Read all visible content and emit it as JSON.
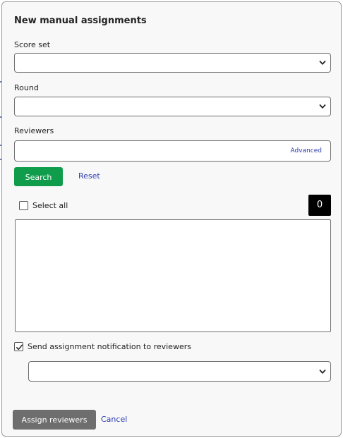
{
  "modal": {
    "title": "New manual assignments"
  },
  "score_set": {
    "label": "Score set",
    "selected": ""
  },
  "round": {
    "label": "Round",
    "selected": ""
  },
  "reviewers": {
    "label": "Reviewers",
    "value": "",
    "advanced_link": "Advanced"
  },
  "search": {
    "button_label": "Search",
    "reset_label": "Reset"
  },
  "selection": {
    "select_all_label": "Select all",
    "select_all_checked": false,
    "count": "0"
  },
  "reviewer_list": {
    "items": []
  },
  "notification": {
    "label": "Send assignment notification to reviewers",
    "checked": true,
    "template_selected": ""
  },
  "footer": {
    "assign_label": "Assign reviewers",
    "cancel_label": "Cancel"
  },
  "colors": {
    "search_button": "#0f9d4c",
    "assign_button": "#6e6e6e",
    "link": "#2b3bb0",
    "count_badge": "#000000"
  }
}
